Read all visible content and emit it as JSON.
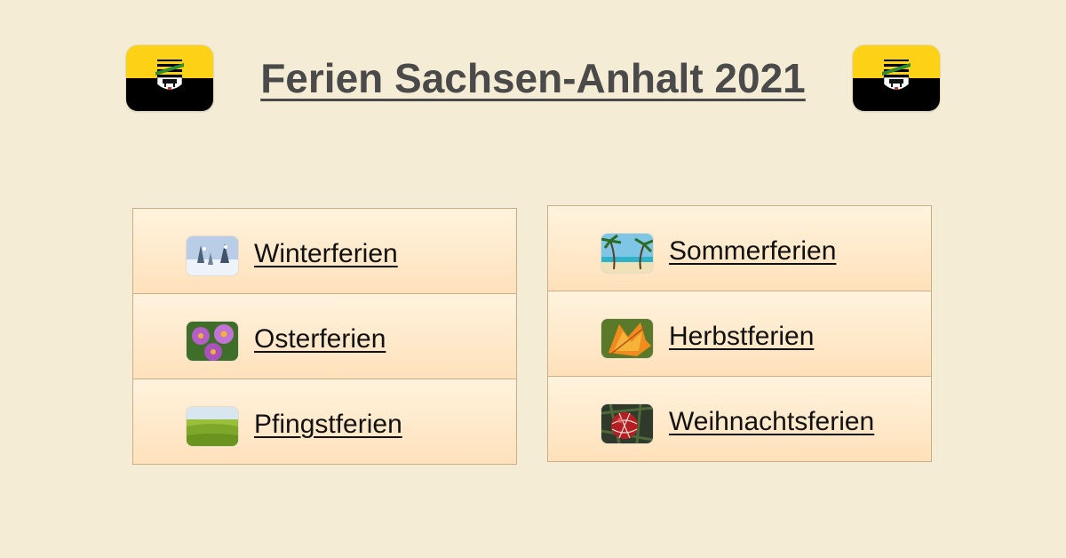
{
  "page": {
    "title": "Ferien Sachsen-Anhalt 2021"
  },
  "flags": {
    "left_icon": "sachsen-anhalt-flag-icon",
    "right_icon": "sachsen-anhalt-flag-icon"
  },
  "colors": {
    "background": "#f5ecd5",
    "flag_yellow": "#fcd116",
    "flag_black": "#000000",
    "row_top": "#fff3de",
    "row_bottom": "#ffe1bb",
    "border": "#c9ae86",
    "title_text": "#4a4a4a"
  },
  "left_column": [
    {
      "label": "Winterferien",
      "icon": "winter-landscape-icon"
    },
    {
      "label": "Osterferien",
      "icon": "purple-flowers-icon"
    },
    {
      "label": "Pfingstferien",
      "icon": "green-meadow-icon"
    }
  ],
  "right_column": [
    {
      "label": "Sommerferien",
      "icon": "palm-beach-icon"
    },
    {
      "label": "Herbstferien",
      "icon": "autumn-leaf-icon"
    },
    {
      "label": "Weihnachtsferien",
      "icon": "christmas-ornament-icon"
    }
  ]
}
